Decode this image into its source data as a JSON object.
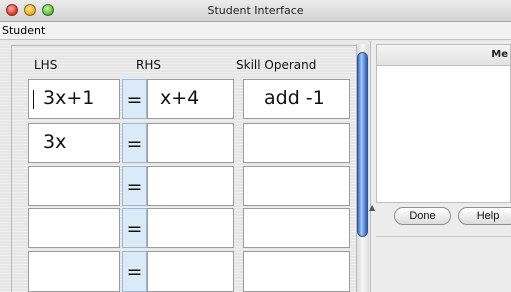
{
  "window": {
    "title": "Student Interface"
  },
  "menubar": {
    "items": [
      "Student"
    ]
  },
  "table": {
    "headers": {
      "lhs": "LHS",
      "rhs": "RHS",
      "operand": "Skill Operand"
    },
    "equals_sign": "=",
    "rows": [
      {
        "lhs": "3x+1",
        "rhs": "x+4",
        "operand": "add -1"
      },
      {
        "lhs": "3x",
        "rhs": "",
        "operand": ""
      },
      {
        "lhs": "",
        "rhs": "",
        "operand": ""
      },
      {
        "lhs": "",
        "rhs": "",
        "operand": ""
      },
      {
        "lhs": "",
        "rhs": "",
        "operand": ""
      }
    ]
  },
  "messages": {
    "header": "Me"
  },
  "buttons": {
    "done": "Done",
    "help": "Help"
  }
}
